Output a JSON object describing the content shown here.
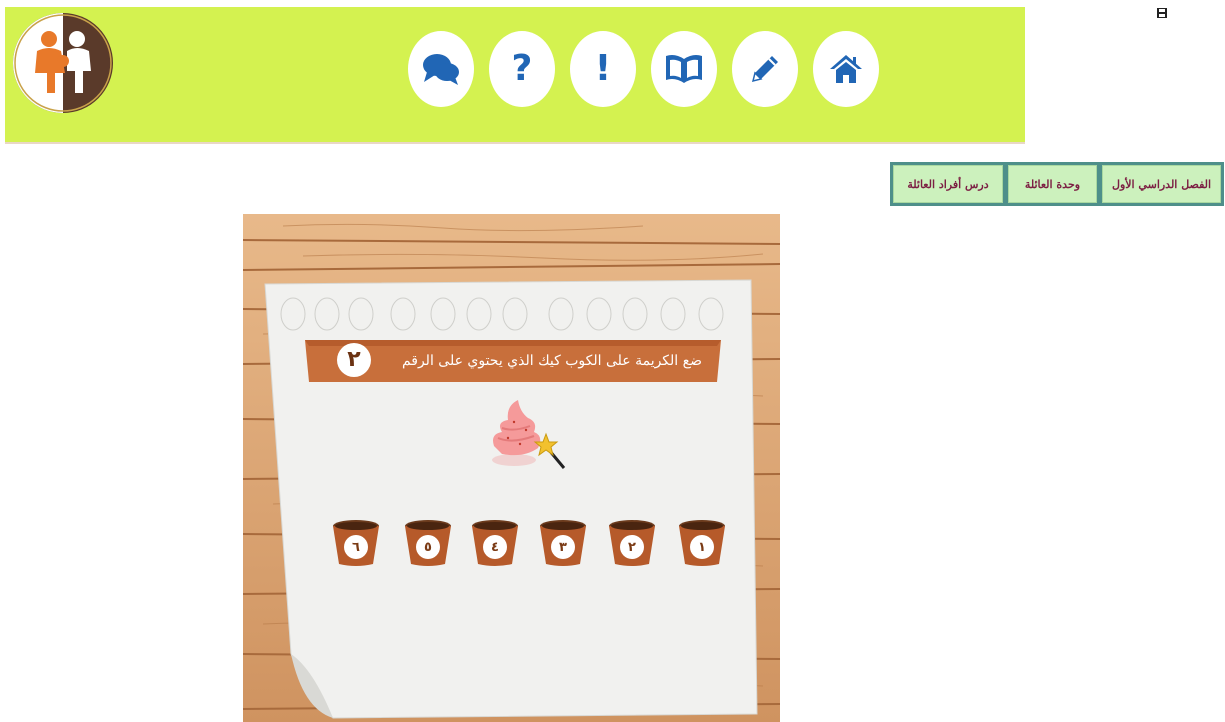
{
  "header": {
    "background_color": "#d4f250",
    "accent_color": "#2166b5",
    "nav": [
      {
        "id": "chat",
        "icon": "chat-bubbles-icon"
      },
      {
        "id": "help",
        "icon": "question-mark-icon",
        "glyph": "?"
      },
      {
        "id": "alert",
        "icon": "exclamation-icon",
        "glyph": "!"
      },
      {
        "id": "book",
        "icon": "open-book-icon"
      },
      {
        "id": "edit",
        "icon": "pencil-icon"
      },
      {
        "id": "home",
        "icon": "home-icon"
      }
    ]
  },
  "toolbar": {
    "print_icon": "print-icon"
  },
  "breadcrumb": {
    "semester": "الفصل الدراسي الأول",
    "unit": "وحدة العائلة",
    "lesson": "درس أفراد العائلة"
  },
  "activity": {
    "instruction": "ضع الكريمة على الكوب كيك الذي يحتوي على الرقم",
    "target_number": "٢",
    "draggable": "cream-topping",
    "cups": [
      "١",
      "٢",
      "٣",
      "٤",
      "٥",
      "٦"
    ]
  }
}
